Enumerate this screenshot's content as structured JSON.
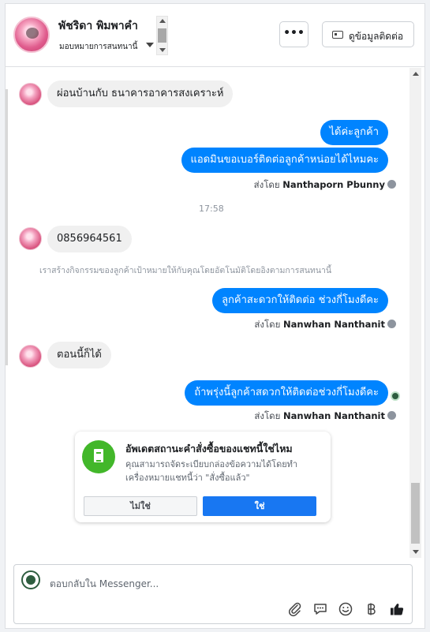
{
  "header": {
    "contact_name": "พัชริดา พิมพาคำ",
    "assign_label": "มอบหมายการสนทนานี้",
    "more_label": "•••",
    "contact_info_label": "ดูข้อมูลติดต่อ"
  },
  "messages": [
    {
      "side": "in",
      "text": "ผ่อนบ้านกับ ธนาคารอาคารสงเคราะห์"
    },
    {
      "side": "out",
      "text": "ได้ค่ะลูกค้า"
    },
    {
      "side": "out",
      "text": "แอดมินขอเบอร์ติดต่อลูกค้าหน่อยได้ไหมคะ"
    },
    {
      "side": "in",
      "text": "0856964561"
    },
    {
      "side": "out",
      "text": "ลูกค้าสะดวกให้ติดต่อ ช่วงกี่โมงดีคะ"
    },
    {
      "side": "in",
      "text": "ตอนนี้ก็ได้"
    },
    {
      "side": "out",
      "text": "ถ้าพรุ่งนี้ลูกค้าสดวกให้ติดต่อช่วงกี่โมงดีคะ"
    }
  ],
  "sent_by_prefix": "ส่งโดย",
  "senders": [
    "Nanthaporn Pbunny",
    "Nanwhan Nanthanit",
    "Nanwhan Nanthanit"
  ],
  "timestamp": "17:58",
  "system_note": "เราสร้างกิจกรรมของลูกค้าเป้าหมายให้กับคุณโดยอัตโนมัติโดยอิงตามการสนทนานี้",
  "order_card": {
    "title": "อัพเดตสถานะคำสั่งซื้อของแชทนี้ใช่ไหม",
    "description": "คุณสามารถจัดระเบียบกล่องข้อความได้โดยทำเครื่องหมายแชทนี้ว่า \"สั่งซื้อแล้ว\"",
    "no_label": "ไม่ใช่",
    "yes_label": "ใช่"
  },
  "composer": {
    "placeholder": "ตอบกลับใน Messenger..."
  },
  "colors": {
    "brand_blue": "#0084ff",
    "button_blue": "#1877f2",
    "order_green": "#42b72a"
  },
  "icons": [
    "attachment-icon",
    "saved-reply-icon",
    "emoji-icon",
    "currency-icon",
    "thumbs-up-icon"
  ]
}
